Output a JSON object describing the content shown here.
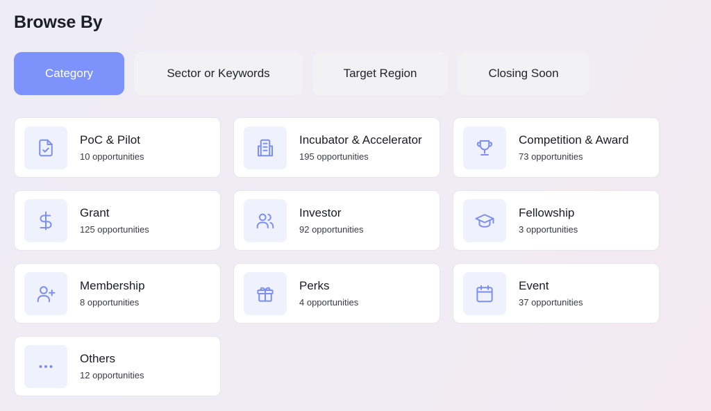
{
  "heading": "Browse By",
  "tabs": [
    {
      "label": "Category",
      "active": true
    },
    {
      "label": "Sector or Keywords",
      "active": false
    },
    {
      "label": "Target Region",
      "active": false
    },
    {
      "label": "Closing Soon",
      "active": false
    }
  ],
  "colors": {
    "accent": "#7d93fb",
    "icon_stroke": "#7b8ef6",
    "icon_bg": "#eff1fd"
  },
  "categories": [
    {
      "title": "PoC & Pilot",
      "count": "10 opportunities",
      "icon": "clipboard-check-icon"
    },
    {
      "title": "Incubator & Accelerator",
      "count": "195 opportunities",
      "icon": "building-icon"
    },
    {
      "title": "Competition & Award",
      "count": "73 opportunities",
      "icon": "trophy-icon"
    },
    {
      "title": "Grant",
      "count": "125 opportunities",
      "icon": "dollar-icon"
    },
    {
      "title": "Investor",
      "count": "92 opportunities",
      "icon": "users-icon"
    },
    {
      "title": "Fellowship",
      "count": "3 opportunities",
      "icon": "graduation-cap-icon"
    },
    {
      "title": "Membership",
      "count": "8 opportunities",
      "icon": "user-plus-icon"
    },
    {
      "title": "Perks",
      "count": "4 opportunities",
      "icon": "gift-icon"
    },
    {
      "title": "Event",
      "count": "37 opportunities",
      "icon": "calendar-icon"
    },
    {
      "title": "Others",
      "count": "12 opportunities",
      "icon": "more-horizontal-icon"
    }
  ]
}
